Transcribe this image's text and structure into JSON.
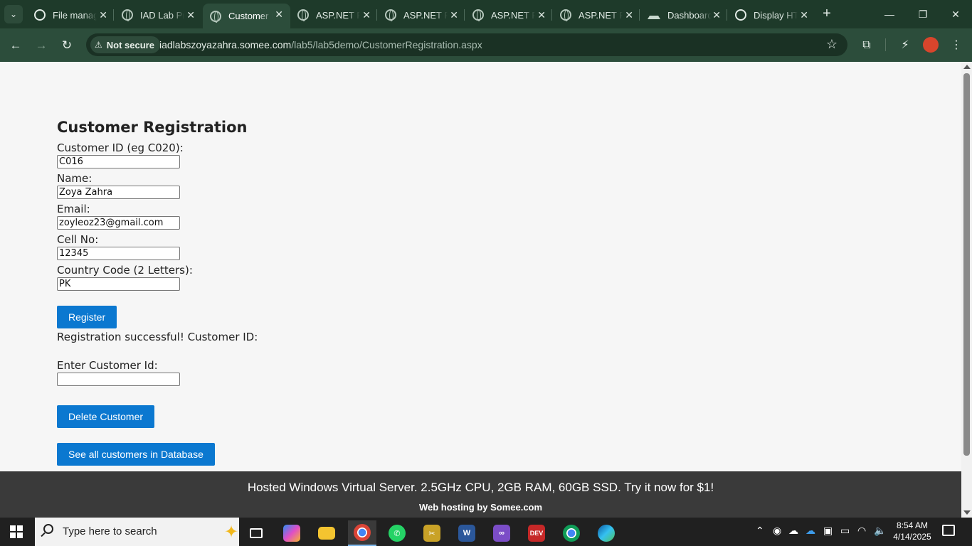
{
  "browser": {
    "tabs": [
      {
        "title": "File manager",
        "icon": "swirl-icon"
      },
      {
        "title": "IAD Lab Project",
        "icon": "globe-icon"
      },
      {
        "title": "Customer Registration",
        "icon": "globe-icon",
        "active": true
      },
      {
        "title": "ASP.NET Page",
        "icon": "globe-icon"
      },
      {
        "title": "ASP.NET Page",
        "icon": "globe-icon"
      },
      {
        "title": "ASP.NET Page",
        "icon": "globe-icon"
      },
      {
        "title": "ASP.NET Page",
        "icon": "globe-icon"
      },
      {
        "title": "Dashboard",
        "icon": "boat-icon"
      },
      {
        "title": "Display HTML",
        "icon": "chatgpt-icon"
      }
    ],
    "security_label": "Not secure",
    "url_host": "iadlabszoyazahra.somee.com",
    "url_path": "/lab5/lab5demo/CustomerRegistration.aspx"
  },
  "form": {
    "heading": "Customer Registration",
    "fields": [
      {
        "label": "Customer ID (eg C020):",
        "value": "C016"
      },
      {
        "label": "Name:",
        "value": "Zoya Zahra"
      },
      {
        "label": "Email:",
        "value": "zoyleoz23@gmail.com"
      },
      {
        "label": "Cell No:",
        "value": "12345"
      },
      {
        "label": "Country Code (2 Letters):",
        "value": "PK"
      }
    ],
    "register_label": "Register",
    "status_message": "Registration successful! Customer ID:",
    "delete_field_label": "Enter Customer Id:",
    "delete_field_value": "",
    "delete_label": "Delete Customer",
    "see_all_label": "See all customers in Database"
  },
  "ad": {
    "headline": "Hosted Windows Virtual Server. 2.5GHz CPU, 2GB RAM, 60GB SSD. Try it now for $1!",
    "footer": "Web hosting by Somee.com"
  },
  "taskbar": {
    "search_placeholder": "Type here to search",
    "time": "8:54 AM",
    "date": "4/14/2025",
    "apps": [
      "task-view",
      "copilot",
      "file-explorer",
      "chrome",
      "whatsapp",
      "snipping-tool",
      "word",
      "visual-studio",
      "dev-cpp",
      "chrome-profile",
      "edge"
    ]
  }
}
